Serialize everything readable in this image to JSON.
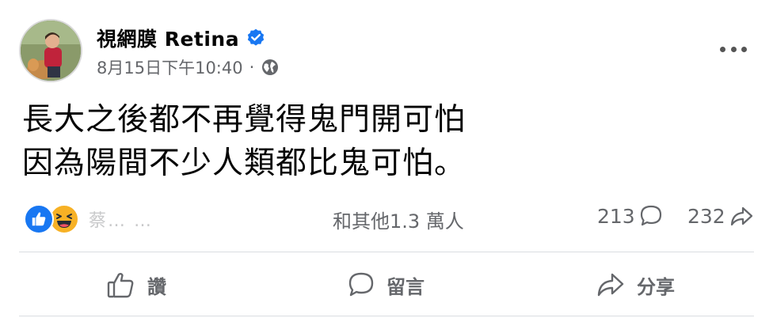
{
  "post": {
    "author": "視網膜 Retina",
    "timestamp": "8月15日下午10:40",
    "separator": "·",
    "privacy_icon": "globe-icon",
    "verified_icon": "verified-badge-icon",
    "body_lines": [
      "長大之後都不再覺得鬼門開可怕",
      "因為陽間不少人類都比鬼可怕。"
    ]
  },
  "reactions": {
    "icons": [
      "like-reaction-icon",
      "haha-reaction-icon"
    ],
    "names_faded": "蔡…   …",
    "count_text": "和其他1.3 萬人"
  },
  "stats": {
    "comments": "213",
    "shares": "232"
  },
  "actions": {
    "like": "讚",
    "comment": "留言",
    "share": "分享"
  },
  "colors": {
    "accent_blue": "#1877f2",
    "haha_yellow": "#f7b125",
    "secondary_text": "#65676b",
    "divider": "#dadde1"
  }
}
